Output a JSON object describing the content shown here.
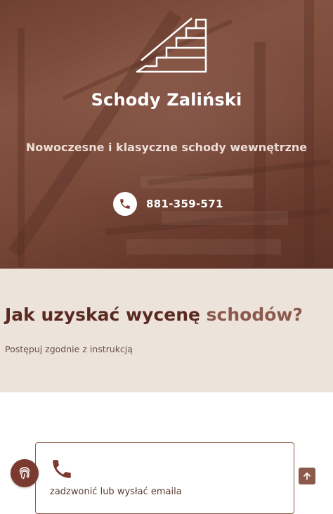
{
  "hero": {
    "brand": "Schody Zaliński",
    "tagline": "Nowoczesne i klasyczne schody wewnętrzne",
    "phone": "881-359-571"
  },
  "how": {
    "title_main": "Jak uzyskać wycenę ",
    "title_accent": "schodów?",
    "subtitle": "Postępuj zgodnie z instrukcją"
  },
  "step_card": {
    "text": "zadzwonić lub wysłać emaila",
    "icon": "phone-icon"
  },
  "widgets": {
    "cookie_icon": "fingerprint-icon",
    "scroll_top_icon": "arrow-up-icon"
  },
  "colors": {
    "brand": "#7a3a2f",
    "accent": "#8b5a4c",
    "section_bg": "#ece3da",
    "heading": "#5a2a22"
  }
}
